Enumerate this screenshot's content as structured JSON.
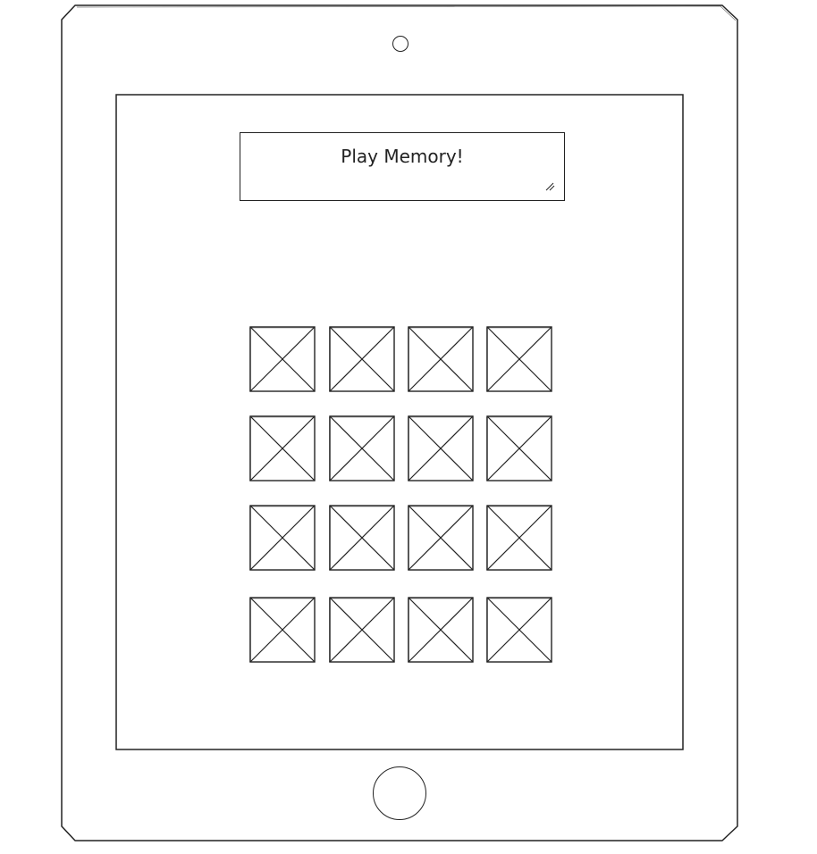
{
  "header": {
    "title": "Play Memory!"
  },
  "grid": {
    "rows": 4,
    "columns": 4,
    "tile_icon": "image-placeholder-icon"
  },
  "device": {
    "type": "tablet",
    "camera_icon": "camera-icon",
    "home_button_icon": "home-button-icon"
  }
}
